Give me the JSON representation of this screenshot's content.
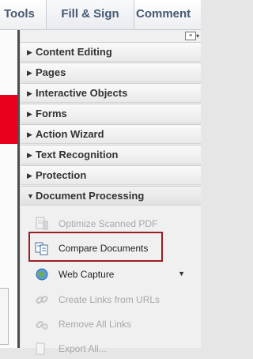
{
  "toolbar": {
    "tabs": [
      {
        "label": "Tools"
      },
      {
        "label": "Fill & Sign"
      },
      {
        "label": "Comment"
      }
    ]
  },
  "panel": {
    "sections": [
      {
        "label": "Content Editing",
        "expanded": false
      },
      {
        "label": "Pages",
        "expanded": false
      },
      {
        "label": "Interactive Objects",
        "expanded": false
      },
      {
        "label": "Forms",
        "expanded": false
      },
      {
        "label": "Action Wizard",
        "expanded": false
      },
      {
        "label": "Text Recognition",
        "expanded": false
      },
      {
        "label": "Protection",
        "expanded": false
      },
      {
        "label": "Document Processing",
        "expanded": true
      }
    ],
    "document_processing_items": [
      {
        "label": "Optimize Scanned PDF",
        "enabled": false,
        "icon": "optimize-scan-icon"
      },
      {
        "label": "Compare Documents",
        "enabled": true,
        "icon": "compare-documents-icon",
        "highlighted": true
      },
      {
        "label": "Web Capture",
        "enabled": true,
        "icon": "globe-icon",
        "has_submenu": true
      },
      {
        "label": "Create Links from URLs",
        "enabled": false,
        "icon": "link-icon"
      },
      {
        "label": "Remove All Links",
        "enabled": false,
        "icon": "unlink-icon"
      },
      {
        "label": "Export All...",
        "enabled": false,
        "icon": "export-icon"
      }
    ]
  },
  "colors": {
    "tab_text": "#465973",
    "highlight_border": "#9b1d22",
    "disabled_text": "#a8a8a8"
  }
}
